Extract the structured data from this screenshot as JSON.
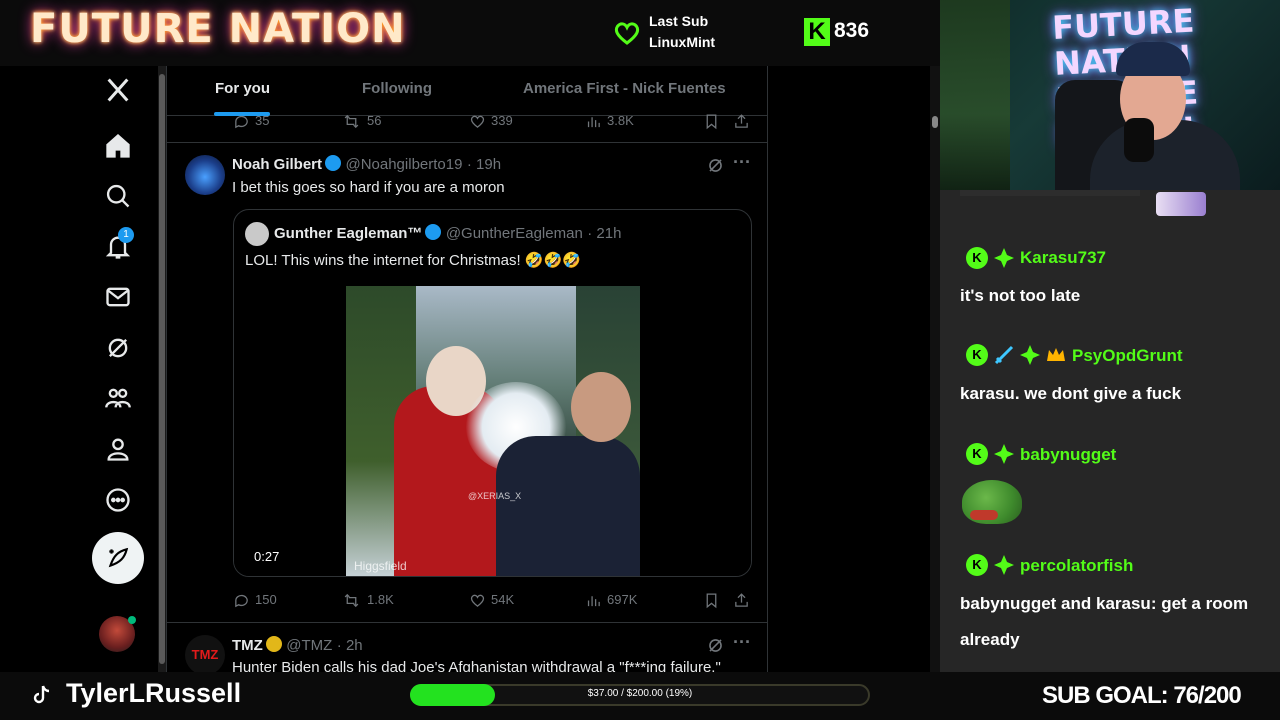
{
  "stream": {
    "logo": "FUTURE NATION",
    "last_sub_title": "Last Sub",
    "last_sub_name": "LinuxMint",
    "viewers": "836",
    "streamer": "TylerLRussell",
    "progress_text": "$37.00 / $200.00 (19%)",
    "progress_fraction": 0.185,
    "sub_goal": "SUB GOAL: 76/200",
    "webcam_sign": "FUTURE NATION",
    "colors": {
      "kick_green": "#53fc18",
      "progress": "#23e21f"
    }
  },
  "nav": {
    "notif_badge": "1",
    "items": [
      "x-logo-icon",
      "home-icon",
      "search-icon",
      "bell-icon",
      "mail-icon",
      "grok-icon",
      "communities-icon",
      "profile-icon",
      "more-icon"
    ]
  },
  "tabs": [
    "For you",
    "Following",
    "America First - Nick Fuentes"
  ],
  "prev_actions": {
    "replies": "35",
    "reposts": "56",
    "likes": "339",
    "views": "3.8K"
  },
  "tweet": {
    "name": "Noah Gilbert",
    "handle": "@Noahgilberto19",
    "time": "· 19h",
    "text": "I bet this goes so hard if you are a moron",
    "quote": {
      "name": "Gunther Eagleman™",
      "handle": "@GuntherEagleman",
      "time": "· 21h",
      "text": "LOL!  This wins the internet for Christmas! 🤣🤣🤣",
      "video_duration": "0:27",
      "watermark": "Higgsfield",
      "inner_watermark": "@XERIAS_X"
    },
    "actions": {
      "replies": "150",
      "reposts": "1.8K",
      "likes": "54K",
      "views": "697K"
    }
  },
  "tweet2": {
    "avatar_text": "TMZ",
    "name": "TMZ",
    "handle": "@TMZ",
    "time": "· 2h",
    "text": "Hunter Biden calls his dad Joe's Afghanistan withdrawal a \"f***ing failure.\""
  },
  "chat": [
    {
      "user": "Karasu737",
      "msg": "it's not too late"
    },
    {
      "user": "PsyOpdGrunt",
      "msg": "karasu. we dont give a fuck"
    },
    {
      "user": "babynugget",
      "msg": ""
    },
    {
      "user": "percolatorfish",
      "msg": "babynugget and karasu: get a room already"
    }
  ]
}
